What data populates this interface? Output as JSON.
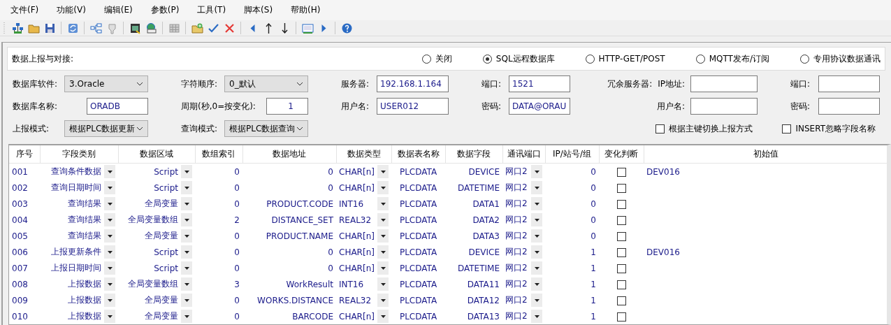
{
  "menu": [
    "文件(F)",
    "功能(V)",
    "编辑(E)",
    "参数(P)",
    "工具(T)",
    "脚本(S)",
    "帮助(H)"
  ],
  "report": {
    "label": "数据上报与对接:",
    "options": [
      {
        "label": "关闭",
        "selected": false
      },
      {
        "label": "SQL远程数据库",
        "selected": true
      },
      {
        "label": "HTTP-GET/POST",
        "selected": false
      },
      {
        "label": "MQTT发布/订阅",
        "selected": false
      },
      {
        "label": "专用协议数据通讯",
        "selected": false
      }
    ]
  },
  "form": {
    "rows": [
      [
        {
          "labels": [
            "数据库软件:"
          ],
          "kind": "select",
          "value": "3.Oracle"
        },
        {
          "labels": [
            "字符顺序:"
          ],
          "kind": "select",
          "value": "0_默认"
        },
        {
          "labels": [
            "服务器:"
          ],
          "kind": "input",
          "value": "192.168.1.164"
        },
        {
          "labels": [
            "端口:"
          ],
          "kind": "input",
          "value": "1521"
        },
        {
          "labels": [
            "冗余服务器:",
            "IP地址:"
          ],
          "kind": "input"
        },
        {
          "labels": [
            "端口:"
          ],
          "kind": "input"
        }
      ],
      [
        {
          "labels": [
            "数据库名称:"
          ],
          "kind": "input",
          "value": "ORADB"
        },
        {
          "labels": [
            "周期(秒,0=按变化):"
          ],
          "kind": "number",
          "value": "1"
        },
        {
          "labels": [
            "用户名:"
          ],
          "kind": "input",
          "value": "USER012"
        },
        {
          "labels": [
            "密码:"
          ],
          "kind": "input",
          "value": "DATA@ORAU"
        },
        {
          "labels": [
            "用户名:"
          ],
          "kind": "input"
        },
        {
          "labels": [
            "密码:"
          ],
          "kind": "input"
        }
      ],
      [
        {
          "labels": [
            "上报模式:"
          ],
          "kind": "select",
          "value": "根据PLC数据更新"
        },
        {
          "labels": [
            "查询模式:"
          ],
          "kind": "select",
          "value": "根据PLC数据查询"
        }
      ]
    ],
    "checkboxes": [
      {
        "label": "根据主键切换上报方式",
        "checked": false
      },
      {
        "label": "INSERT忽略字段名称",
        "checked": false
      }
    ]
  },
  "table": {
    "columns": [
      "序号",
      "字段类别",
      "数据区域",
      "数组索引",
      "数据地址",
      "数据类型",
      "数据表名称",
      "数据字段",
      "通讯端口",
      "IP/站号/组",
      "变化判断",
      "初始值"
    ],
    "rows": [
      {
        "no": "001",
        "category": "查询条件数据",
        "area": "Script",
        "index": "0",
        "address": "0",
        "type": "CHAR[n]",
        "table": "PLCDATA",
        "field": "DEVICE",
        "port": "网口2",
        "station": "0",
        "change": false,
        "initial": "DEV016"
      },
      {
        "no": "002",
        "category": "查询日期时间",
        "area": "Script",
        "index": "0",
        "address": "0",
        "type": "CHAR[n]",
        "table": "PLCDATA",
        "field": "DATETIME",
        "port": "网口2",
        "station": "0",
        "change": false
      },
      {
        "no": "003",
        "category": "查询结果",
        "area": "全局变量",
        "index": "0",
        "address": "PRODUCT.CODE",
        "type": "INT16",
        "table": "PLCDATA",
        "field": "DATA1",
        "port": "网口2",
        "station": "0",
        "change": false
      },
      {
        "no": "004",
        "category": "查询结果",
        "area": "全局变量数组",
        "index": "2",
        "address": "DISTANCE_SET",
        "type": "REAL32",
        "table": "PLCDATA",
        "field": "DATA2",
        "port": "网口2",
        "station": "0",
        "change": false
      },
      {
        "no": "005",
        "category": "查询结果",
        "area": "全局变量",
        "index": "0",
        "address": "PRODUCT.NAME",
        "type": "CHAR[n]",
        "table": "PLCDATA",
        "field": "DATA3",
        "port": "网口2",
        "station": "0",
        "change": false
      },
      {
        "no": "006",
        "category": "上报更新条件",
        "area": "Script",
        "index": "0",
        "address": "0",
        "type": "CHAR[n]",
        "table": "PLCDATA",
        "field": "DEVICE",
        "port": "网口2",
        "station": "1",
        "change": false,
        "initial": "DEV016"
      },
      {
        "no": "007",
        "category": "上报日期时间",
        "area": "Script",
        "index": "0",
        "address": "0",
        "type": "CHAR[n]",
        "table": "PLCDATA",
        "field": "DATETIME",
        "port": "网口2",
        "station": "1",
        "change": false
      },
      {
        "no": "008",
        "category": "上报数据",
        "area": "全局变量数组",
        "index": "3",
        "address": "WorkResult",
        "type": "INT16",
        "table": "PLCDATA",
        "field": "DATA11",
        "port": "网口2",
        "station": "1",
        "change": false
      },
      {
        "no": "009",
        "category": "上报数据",
        "area": "全局变量",
        "index": "0",
        "address": "WORKS.DISTANCE",
        "type": "REAL32",
        "table": "PLCDATA",
        "field": "DATA12",
        "port": "网口2",
        "station": "1",
        "change": false
      },
      {
        "no": "010",
        "category": "上报数据",
        "area": "全局变量",
        "index": "0",
        "address": "BARCODE",
        "type": "CHAR[n]",
        "table": "PLCDATA",
        "field": "DATA13",
        "port": "网口2",
        "station": "1",
        "change": false
      }
    ]
  }
}
